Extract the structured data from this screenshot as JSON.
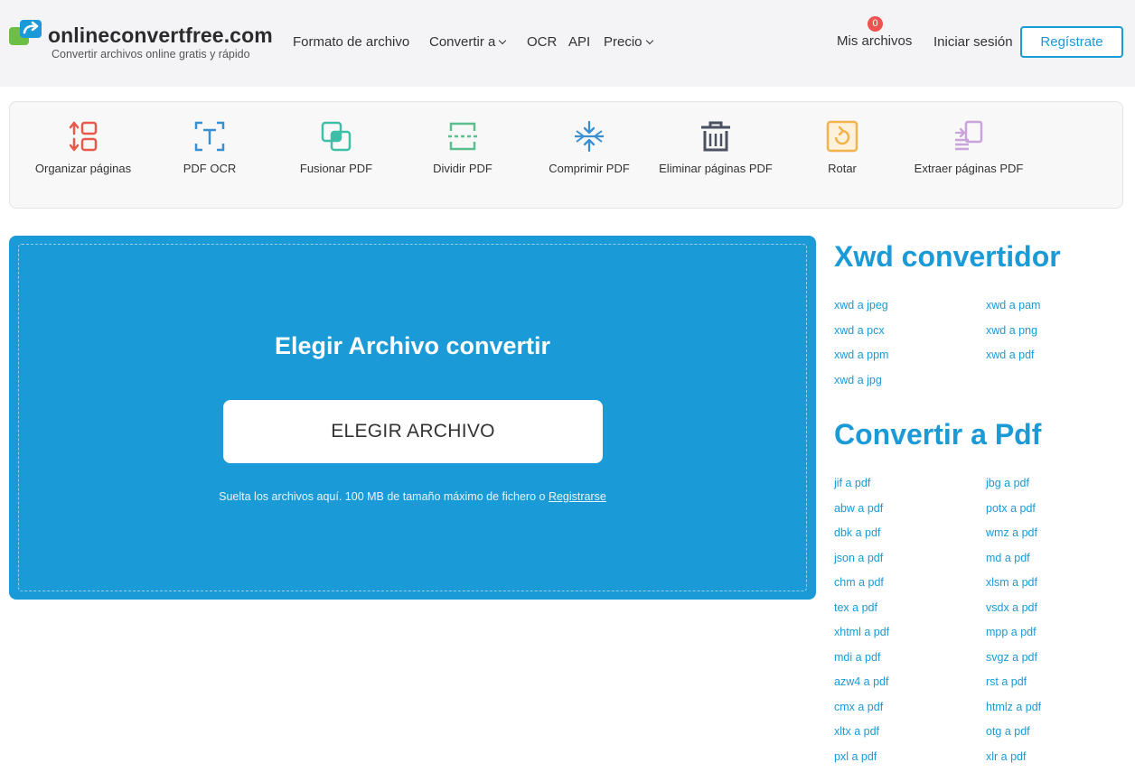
{
  "header": {
    "logo_text": "onlineconvertfree.com",
    "tagline": "Convertir archivos online gratis y rápido",
    "nav": {
      "formato": "Formato de archivo",
      "convertir": "Convertir a",
      "ocr": "OCR",
      "api": "API",
      "precio": "Precio"
    },
    "my_files": "Mis archivos",
    "my_files_count": "0",
    "login": "Iniciar sesión",
    "register": "Regístrate"
  },
  "tools": [
    {
      "label": "Organizar páginas",
      "icon": "organize-pages-icon",
      "color": "#e8584b"
    },
    {
      "label": "PDF OCR",
      "icon": "ocr-icon",
      "color": "#3a8fd1"
    },
    {
      "label": "Fusionar PDF",
      "icon": "merge-icon",
      "color": "#3fbfa7"
    },
    {
      "label": "Dividir PDF",
      "icon": "split-icon",
      "color": "#5dbf8e"
    },
    {
      "label": "Comprimir PDF",
      "icon": "compress-icon",
      "color": "#3a8fd1"
    },
    {
      "label": "Eliminar páginas PDF",
      "icon": "trash-icon",
      "color": "#4a5160"
    },
    {
      "label": "Rotar",
      "icon": "rotate-icon",
      "color": "#f2b24c"
    },
    {
      "label": "Extraer páginas PDF",
      "icon": "extract-icon",
      "color": "#c9a3d9"
    }
  ],
  "upload": {
    "title": "Elegir Archivo convertir",
    "button": "ELEGIR ARCHIVO",
    "drop_text": "Suelta los archivos aquí. 100 MB de tamaño máximo de fichero o",
    "register_link": "Registrarse"
  },
  "xwd": {
    "title": "Xwd convertidor",
    "links": [
      "xwd a jpeg",
      "xwd a pam",
      "xwd a pcx",
      "xwd a png",
      "xwd a ppm",
      "xwd a pdf",
      "xwd a jpg"
    ]
  },
  "pdf": {
    "title": "Convertir a Pdf",
    "links": [
      "jif a pdf",
      "jbg a pdf",
      "abw a pdf",
      "potx a pdf",
      "dbk a pdf",
      "wmz a pdf",
      "json a pdf",
      "md a pdf",
      "chm a pdf",
      "xlsm a pdf",
      "tex a pdf",
      "vsdx a pdf",
      "xhtml a pdf",
      "mpp a pdf",
      "mdi a pdf",
      "svgz a pdf",
      "azw4 a pdf",
      "rst a pdf",
      "cmx a pdf",
      "htmlz a pdf",
      "xltx a pdf",
      "otg a pdf",
      "pxl a pdf",
      "xlr a pdf"
    ]
  },
  "colors": {
    "accent": "#1a9ad6",
    "badge": "#ef5350",
    "header_bg": "#f4f4f6"
  }
}
